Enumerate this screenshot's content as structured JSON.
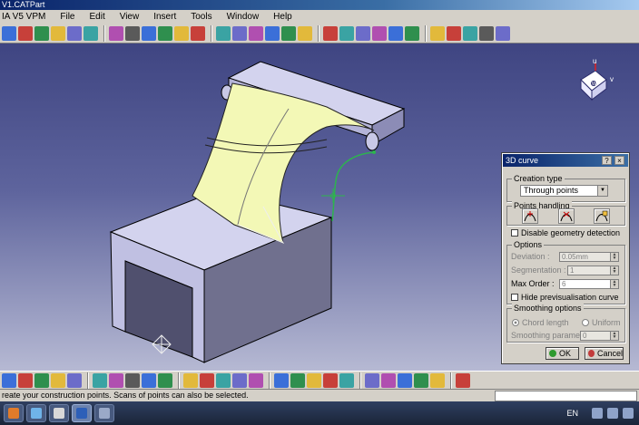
{
  "window": {
    "title": "V1.CATPart"
  },
  "menu": {
    "items": [
      "IA V5 VPM",
      "File",
      "Edit",
      "View",
      "Insert",
      "Tools",
      "Window",
      "Help"
    ]
  },
  "toolbar": {
    "icons": [
      "#3b6fd8",
      "#c7403a",
      "#2f8f4e",
      "#e2b93b",
      "#6c6cc9",
      "#3aa3a3",
      "#b04fb0",
      "#5a5a5a",
      "#3b6fd8",
      "#2f8f4e",
      "#e2b93b",
      "#c7403a",
      "#3aa3a3",
      "#6c6cc9",
      "#b04fb0",
      "#3b6fd8",
      "#2f8f4e",
      "#e2b93b",
      "#c7403a",
      "#3aa3a3",
      "#6c6cc9",
      "#b04fb0",
      "#3b6fd8",
      "#2f8f4e",
      "#e2b93b",
      "#c7403a",
      "#3aa3a3",
      "#5a5a5a",
      "#6c6cc9"
    ]
  },
  "dialog": {
    "title": "3D curve",
    "help_label": "?",
    "close_label": "×",
    "creation_type_label": "Creation type",
    "creation_type_value": "Through points",
    "points_handling_label": "Points handling",
    "disable_geometry_detection": "Disable geometry detection",
    "options_label": "Options",
    "deviation_label": "Deviation :",
    "deviation_value": "0.05mm",
    "segmentation_label": "Segmentation :",
    "segmentation_value": "1",
    "max_order_label": "Max Order :",
    "max_order_value": "6",
    "hide_previsualisation": "Hide previsualisation curve",
    "smoothing_label": "Smoothing options",
    "chord_length": "Chord length",
    "uniform": "Uniform",
    "smoothing_param_label": "Smoothing parameter",
    "smoothing_param_value": "0",
    "ok_label": "OK",
    "cancel_label": "Cancel"
  },
  "compass": {
    "u_label": "u",
    "v_label": "v",
    "w_label": "w"
  },
  "status": {
    "message": "reate your construction points. Scans of points can also be selected.",
    "command_value": ""
  },
  "taskbar": {
    "language": "EN"
  },
  "colors": {
    "surface": "#f3f8b6",
    "body": "#c8c8e6",
    "curve": "#2db44e",
    "ok": "#2e9a2e",
    "cancel": "#c23b3b"
  }
}
